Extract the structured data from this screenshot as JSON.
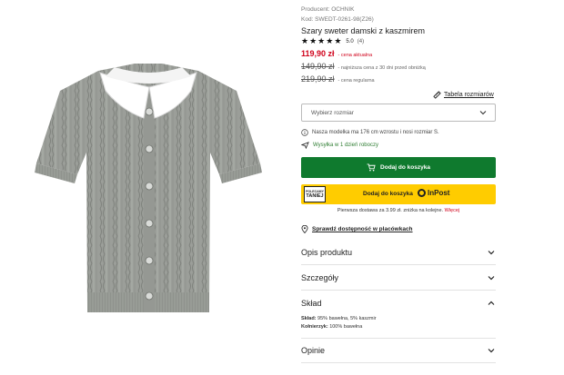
{
  "product": {
    "producer": "Producent: OCHNIK",
    "code": "Kod: SWEDT-0261-98(Z26)",
    "title": "Szary sweter damski z kaszmirem",
    "rating_score": "5.0",
    "rating_count": "(4)",
    "stars": 5
  },
  "prices": {
    "current": "119,90 zł",
    "current_note": "- cena aktualna",
    "lowest": "149,90 zł",
    "lowest_note": "- najniższa cena z 30 dni przed obniżką",
    "regular": "219,90 zł",
    "regular_note": "- cena regularna"
  },
  "size": {
    "chart_link": "Tabela rozmiarów",
    "select_placeholder": "Wybierz rozmiar"
  },
  "info": {
    "model_note": "Nasza modelka ma 176 cm wzrostu i nosi rozmiar S.",
    "shipping": "Wysyłka w 1 dzień roboczy"
  },
  "buttons": {
    "add_to_cart": "Dodaj do koszyka",
    "inpost_badge_line1": "POLECAMY",
    "inpost_badge_line2": "TANIEJ",
    "inpost_label": "Dodaj do koszyka",
    "inpost_brand": "InPost"
  },
  "delivery": {
    "note": "Pierwsza dostawa za 3.99 zł. zniżka na kolejne.",
    "more": "Więcej"
  },
  "availability": "Sprawdź dostępność w placówkach",
  "accordion": [
    {
      "label": "Opis produktu",
      "expanded": false
    },
    {
      "label": "Szczegóły",
      "expanded": false
    },
    {
      "label": "Skład",
      "expanded": true
    },
    {
      "label": "Opinie",
      "expanded": false
    }
  ],
  "composition": {
    "material_label": "Skład:",
    "material_value": "95% bawełna, 5% kaszmir",
    "collar_label": "Kołnierzyk:",
    "collar_value": "100% bawełna"
  },
  "colors": {
    "price_red": "#d0021b",
    "cart_green": "#0f7a2e",
    "inpost_yellow": "#ffcc00",
    "sweater_grey": "#9a9d98"
  }
}
